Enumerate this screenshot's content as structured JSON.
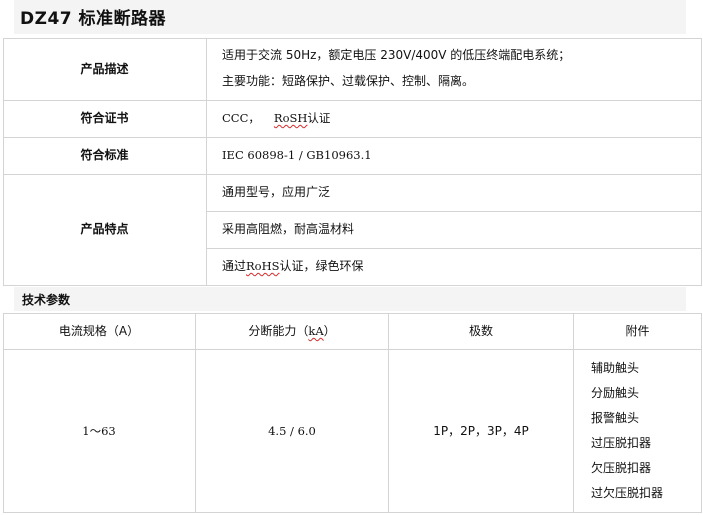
{
  "title": "DZ47  标准断路器",
  "spec_table": {
    "description": {
      "label": "产品描述",
      "line1": "适用于交流 50Hz，额定电压 230V/400V 的低压终端配电系统；",
      "line2": "主要功能：短路保护、过载保护、控制、隔离。"
    },
    "certification": {
      "label": "符合证书",
      "prefix": "CCC，",
      "rosh": "RoSH",
      "suffix": "认证"
    },
    "standard": {
      "label": "符合标准",
      "value": "IEC 60898-1 / GB10963.1"
    },
    "features": {
      "label": "产品特点",
      "item1": "通用型号，应用广泛",
      "item2": "采用高阻燃，耐高温材料",
      "item3_prefix": "通过",
      "item3_rohs": "RoHS",
      "item3_suffix": "认证，绿色环保"
    }
  },
  "tech_section": {
    "title": "技术参数",
    "headers": {
      "current": "电流规格（A）",
      "breaking_prefix": "分断能力（",
      "breaking_unit": "kA",
      "breaking_suffix": "）",
      "poles": "极数",
      "accessories": "附件"
    },
    "row": {
      "current": "1～63",
      "breaking": "4.5 / 6.0",
      "poles": "1P，2P，3P，4P",
      "accessories": [
        "辅助触头",
        "分励触头",
        "报警触头",
        "过压脱扣器",
        "欠压脱扣器",
        "过欠压脱扣器"
      ]
    }
  }
}
